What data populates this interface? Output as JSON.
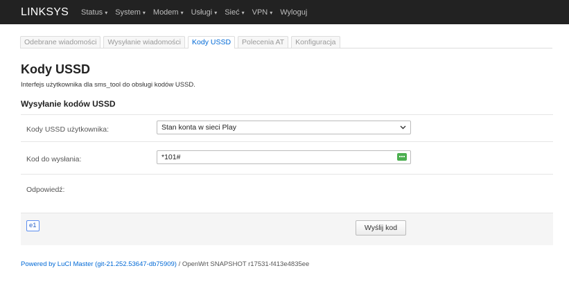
{
  "navbar": {
    "brand": "LINKSYS",
    "menu": [
      "Status",
      "System",
      "Modem",
      "Usługi",
      "Sieć",
      "VPN"
    ],
    "logout": "Wyloguj",
    "caret": "▾"
  },
  "tabs": [
    "Odebrane wiadomości",
    "Wysyłanie wiadomości",
    "Kody USSD",
    "Polecenia AT",
    "Konfiguracja"
  ],
  "active_tab": "Kody USSD",
  "page": {
    "title": "Kody USSD",
    "description": "Interfejs użytkownika dla sms_tool do obsługi kodów USSD."
  },
  "section": {
    "title": "Wysyłanie kodów USSD",
    "user_codes_label": "Kody USSD użytkownika:",
    "user_codes_selected": "Stan konta w sieci Play",
    "code_label": "Kod do wysłania:",
    "code_value": "*101#",
    "response_label": "Odpowiedź:"
  },
  "actions": {
    "badge": "e1",
    "send_button": "Wyślij kod"
  },
  "footer": {
    "link": "Powered by LuCI Master (git-21.252.53647-db75909)",
    "text": " / OpenWrt SNAPSHOT r17531-f413e4835ee"
  },
  "colors": {
    "navbar_bg": "#222222",
    "link": "#0069d6",
    "keyboard_icon": "#4caf50"
  }
}
